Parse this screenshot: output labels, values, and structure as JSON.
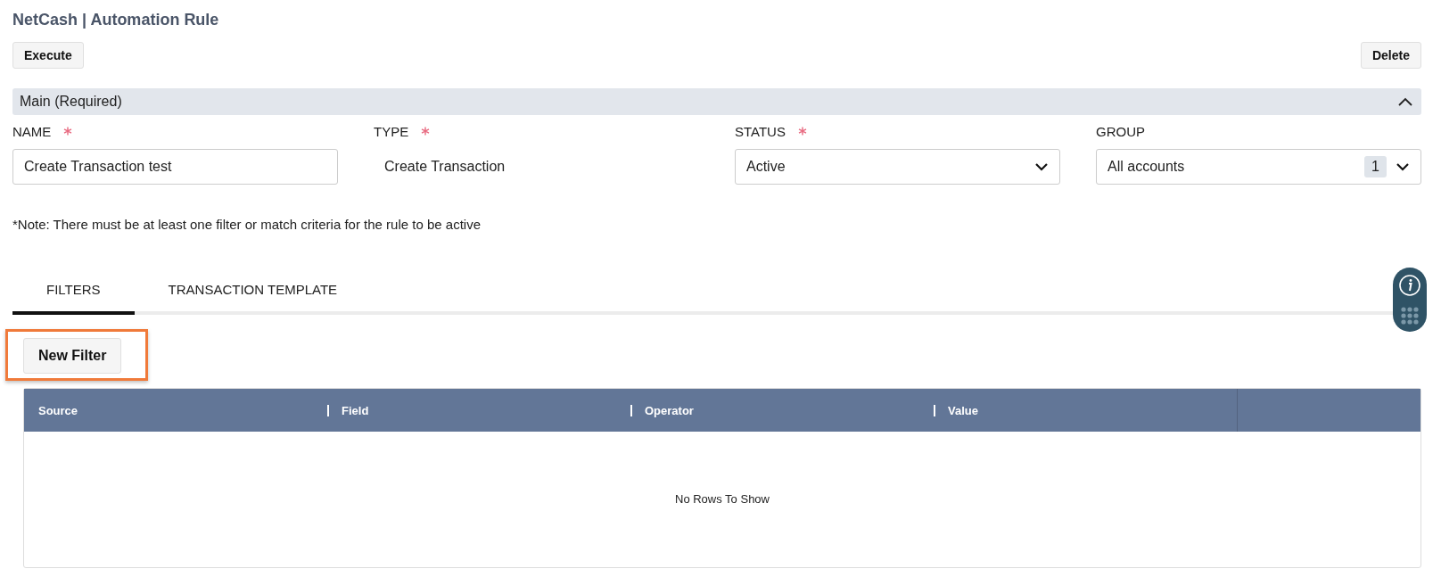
{
  "header": {
    "title": "NetCash | Automation Rule"
  },
  "toolbar": {
    "buttons": [
      "Execute",
      "Delete"
    ]
  },
  "section": {
    "title": "Main (Required)",
    "expanded": true
  },
  "fields": [
    {
      "kind": "text",
      "label": "NAME",
      "required": true,
      "value": "Create Transaction test"
    },
    {
      "kind": "static",
      "label": "TYPE",
      "required": true,
      "value": "Create Transaction"
    },
    {
      "kind": "select",
      "label": "STATUS",
      "required": true,
      "value": "Active"
    },
    {
      "kind": "select",
      "label": "GROUP",
      "required": false,
      "value": "All accounts",
      "count": "1"
    }
  ],
  "note": "*Note: There must be at least one filter or match criteria for the rule to be active",
  "tabs": [
    {
      "label": "FILTERS",
      "selected": true
    },
    {
      "label": "TRANSACTION TEMPLATE",
      "selected": false
    }
  ],
  "new_filter_button": {
    "label": "New Filter",
    "highlighted": true
  },
  "table": {
    "columns": [
      "Source",
      "Field",
      "Operator",
      "Value"
    ],
    "empty_message": "No Rows To Show"
  }
}
